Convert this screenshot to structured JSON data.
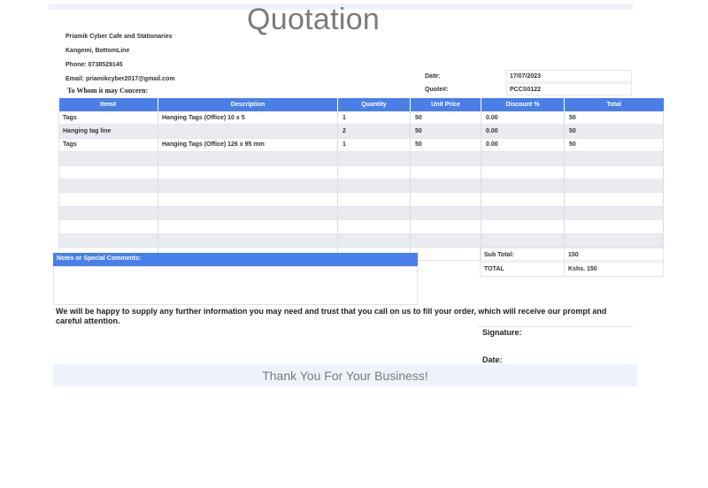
{
  "title": "Quotation",
  "company": {
    "name": "Priamik Cyber Cafe and Stationaries",
    "address": "Kangemi, BottomLine",
    "phone": "Phone:  0738529145",
    "email": "Email: priamikcyber2017@gmail.com"
  },
  "to_whom": "To Whom it may Concern:",
  "meta": {
    "date_label": "Date:",
    "date_value": "17/07/2023",
    "quote_label": "Quote#:",
    "quote_value": "PCCS0122"
  },
  "table": {
    "headers": [
      "Item#",
      "Description",
      "Quantity",
      "Unit Price",
      "Discount %",
      "Total"
    ],
    "rows": [
      [
        "Tags",
        "Hanging Tags (Office) 10 x 5",
        "1",
        "50",
        "0.00",
        "50"
      ],
      [
        "Hanging tag line",
        "",
        "2",
        "50",
        "0.00",
        "50"
      ],
      [
        "Tags",
        "Hanging Tags (Office) 126 x 95 mm",
        "1",
        "50",
        "0.00",
        "50"
      ],
      [
        "",
        "",
        "",
        "",
        "",
        ""
      ],
      [
        "",
        "",
        "",
        "",
        "",
        ""
      ],
      [
        "",
        "",
        "",
        "",
        "",
        ""
      ],
      [
        "",
        "",
        "",
        "",
        "",
        ""
      ],
      [
        "",
        "",
        "",
        "",
        "",
        ""
      ],
      [
        "",
        "",
        "",
        "",
        "",
        ""
      ],
      [
        "",
        "",
        "",
        "",
        "",
        ""
      ],
      [
        "",
        "",
        "",
        "",
        "",
        ""
      ]
    ]
  },
  "notes": {
    "label": "Notes or Special Comments:"
  },
  "totals": {
    "subtotal_label": "Sub Total:",
    "subtotal_value": "150",
    "total_label": "TOTAL",
    "total_value": "Kshs. 150"
  },
  "closing": "We will be happy to supply any further information you may need and trust that you call on us to fill your order, which will receive our prompt and careful attention.",
  "signature_label": "Signature:",
  "sign_date_label": "Date:",
  "thanks": "Thank You For Your Business!"
}
